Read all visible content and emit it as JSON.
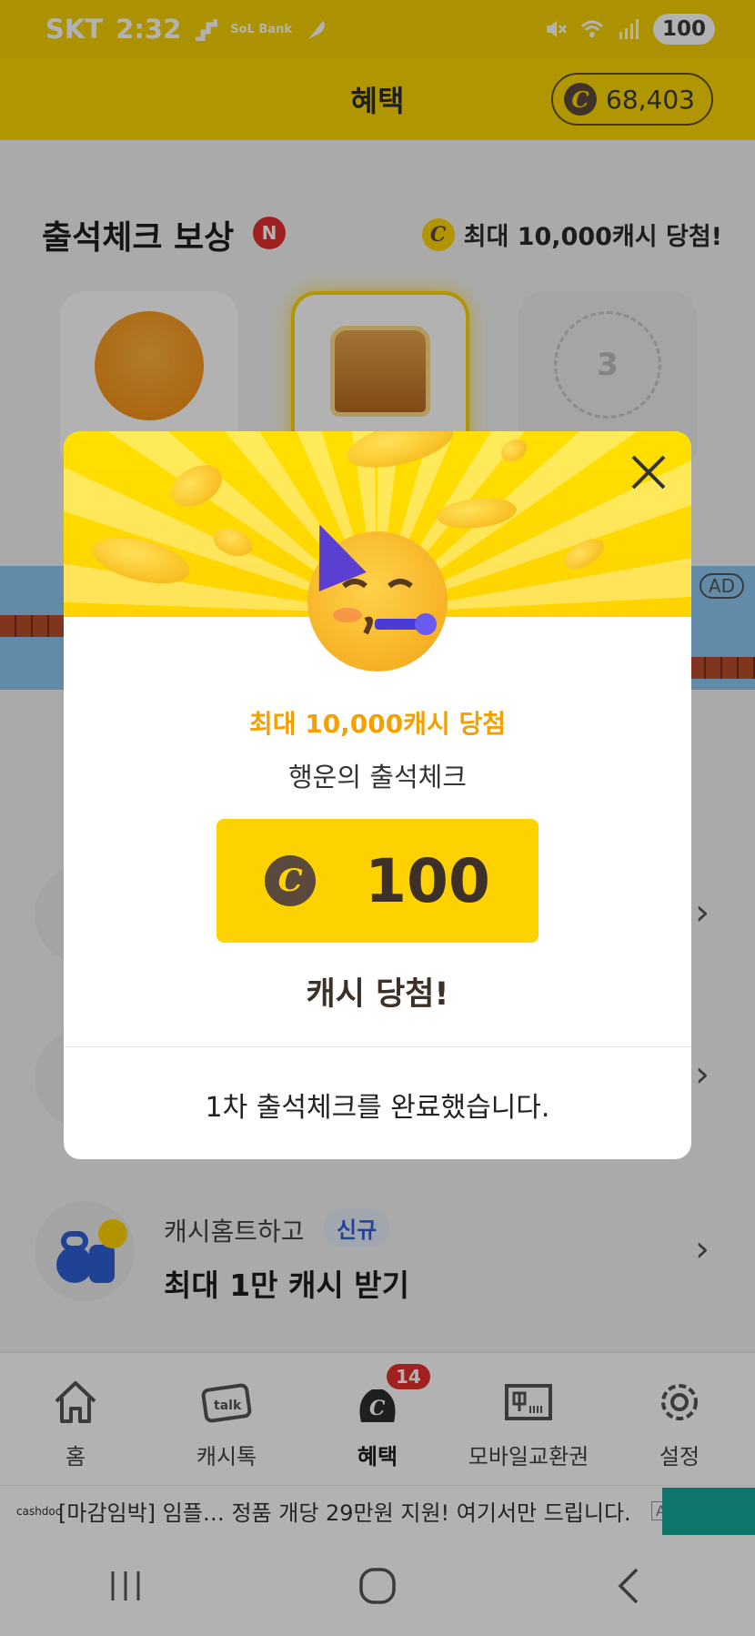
{
  "status_bar": {
    "carrier": "SKT",
    "time": "2:32",
    "battery": "100",
    "bank_label": "SoL Bank"
  },
  "header": {
    "title": "혜택",
    "points": "68,403",
    "coin_symbol": "C"
  },
  "attendance": {
    "title": "출석체크 보상",
    "new_badge": "N",
    "max_reward": "최대 10,000캐시 당첨!",
    "cards": [
      {
        "kind": "coins"
      },
      {
        "kind": "chest"
      },
      {
        "kind": "locked",
        "day": "3"
      }
    ]
  },
  "ad_banner": {
    "tag": "AD"
  },
  "list_items": [
    {
      "icon": "red-gift-icon"
    },
    {
      "icon": "red-box-icon"
    },
    {
      "icon": "kettlebell-icon",
      "subtitle": "캐시홈트하고",
      "badge": "신규",
      "title": "최대 1만 캐시 받기"
    }
  ],
  "bottom_nav": {
    "items": [
      {
        "label": "홈",
        "icon": "home-icon"
      },
      {
        "label": "캐시톡",
        "icon": "talk-icon"
      },
      {
        "label": "혜택",
        "icon": "cash-bag-icon",
        "badge": "14",
        "active": true
      },
      {
        "label": "모바일교환권",
        "icon": "gift-card-icon"
      },
      {
        "label": "설정",
        "icon": "gear-icon"
      }
    ]
  },
  "footer_ad": {
    "logo": "cashdoc",
    "text": "[마감임박] 임플…  정품 개당 29만원 지원! 여기서만 드립니다.",
    "tag": "AD"
  },
  "modal": {
    "subhead": "최대 10,000캐시 당첨",
    "subtitle": "행운의 출석체크",
    "amount": "100",
    "coin_symbol": "C",
    "result": "캐시 당첨!",
    "footer": "1차 출석체크를 완료했습니다."
  },
  "colors": {
    "brand_yellow": "#fdd700",
    "accent_orange": "#f3a000",
    "badge_red": "#e4322e",
    "new_blue": "#3360d9"
  }
}
